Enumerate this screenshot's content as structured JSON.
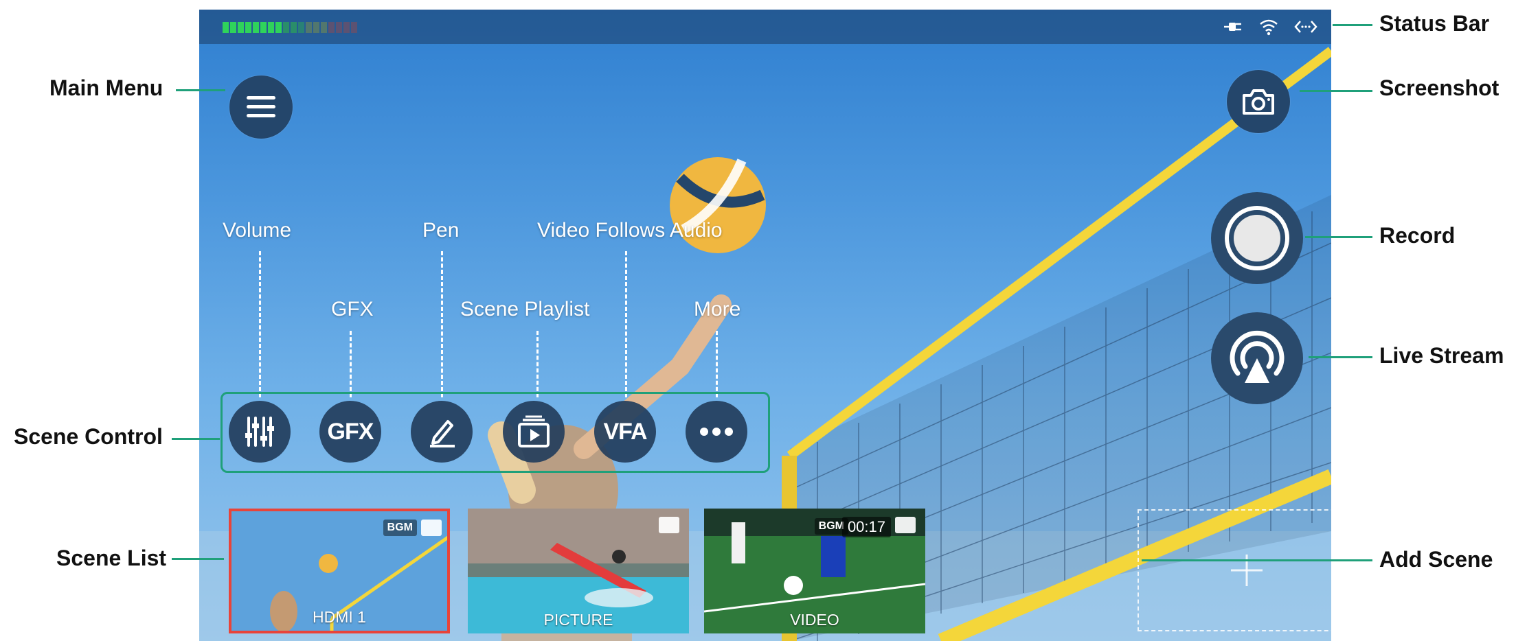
{
  "status_bar": {
    "icons": [
      "power-plug-icon",
      "wifi-icon",
      "network-arrows-icon"
    ]
  },
  "buttons": {
    "main_menu_icon": "hamburger-menu-icon",
    "screenshot_icon": "camera-icon",
    "record_icon": "record-circle-icon",
    "live_stream_icon": "broadcast-icon"
  },
  "scene_control": {
    "buttons": [
      {
        "label": "Volume",
        "icon": "mixer-sliders-icon",
        "text": ""
      },
      {
        "label": "GFX",
        "icon": "gfx-icon",
        "text": "GFX"
      },
      {
        "label": "Pen",
        "icon": "pen-icon",
        "text": ""
      },
      {
        "label": "Scene Playlist",
        "icon": "playlist-icon",
        "text": ""
      },
      {
        "label": "Video Follows Audio",
        "icon": "vfa-icon",
        "text": "VFA"
      },
      {
        "label": "More",
        "icon": "more-dots-icon",
        "text": ""
      }
    ]
  },
  "scenes": [
    {
      "label": "HDMI 1",
      "badge": "BGM",
      "source_icon": "hdmi-icon",
      "selected": true
    },
    {
      "label": "PICTURE",
      "badge": "",
      "source_icon": "image-icon",
      "selected": false
    },
    {
      "label": "VIDEO",
      "badge": "BGM",
      "time": "00:17",
      "source_icon": "play-icon",
      "selected": false
    }
  ],
  "add_scene_icon": "plus-icon",
  "callouts": {
    "status_bar": "Status Bar",
    "main_menu": "Main Menu",
    "screenshot": "Screenshot",
    "record": "Record",
    "live_stream": "Live Stream",
    "scene_control": "Scene Control",
    "scene_list": "Scene List",
    "add_scene": "Add Scene"
  },
  "colors": {
    "callout_line": "#1fa07a",
    "selected_scene_border": "#e8443a",
    "net_yellow": "#f4d63a",
    "button_bg": "#24466b"
  }
}
